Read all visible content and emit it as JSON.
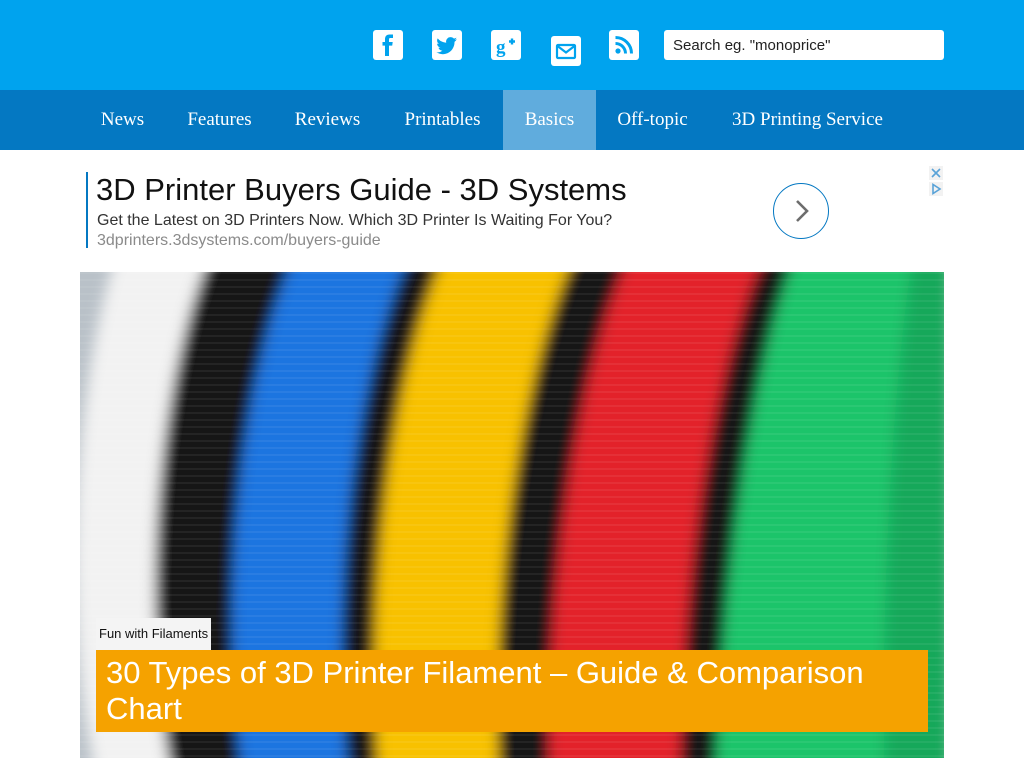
{
  "header": {
    "social": [
      {
        "name": "facebook-icon",
        "color": "#3b5998"
      },
      {
        "name": "twitter-icon",
        "color": "#1da1f2"
      },
      {
        "name": "google-plus-icon",
        "color": "#dd4b39"
      },
      {
        "name": "email-icon",
        "color": "#00a3ee"
      },
      {
        "name": "rss-icon",
        "color": "#f26522"
      }
    ],
    "search": {
      "placeholder": "Search eg. \"monoprice\"",
      "value": ""
    }
  },
  "nav": {
    "items": [
      {
        "label": "News"
      },
      {
        "label": "Features"
      },
      {
        "label": "Reviews"
      },
      {
        "label": "Printables"
      },
      {
        "label": "Basics",
        "active": true
      },
      {
        "label": "Off-topic"
      },
      {
        "label": "3D Printing Service"
      }
    ]
  },
  "ad": {
    "title": "3D Printer Buyers Guide - 3D Systems",
    "description": "Get the Latest on 3D Printers Now. Which 3D Printer Is Waiting For You?",
    "url": "3dprinters.3dsystems.com/buyers-guide",
    "arrow_icon": "chevron-right-icon",
    "badges": [
      "close-icon",
      "adchoices-icon"
    ]
  },
  "hero": {
    "image": "colorful-filament-spools",
    "category": "Fun with Filaments",
    "title": "30 Types of 3D Printer Filament – Guide & Comparison Chart"
  },
  "colors": {
    "header_bg": "#00a3ee",
    "nav_bg": "#0478c2",
    "nav_active": "#60acdd",
    "headline_bg": "#f5a200"
  }
}
